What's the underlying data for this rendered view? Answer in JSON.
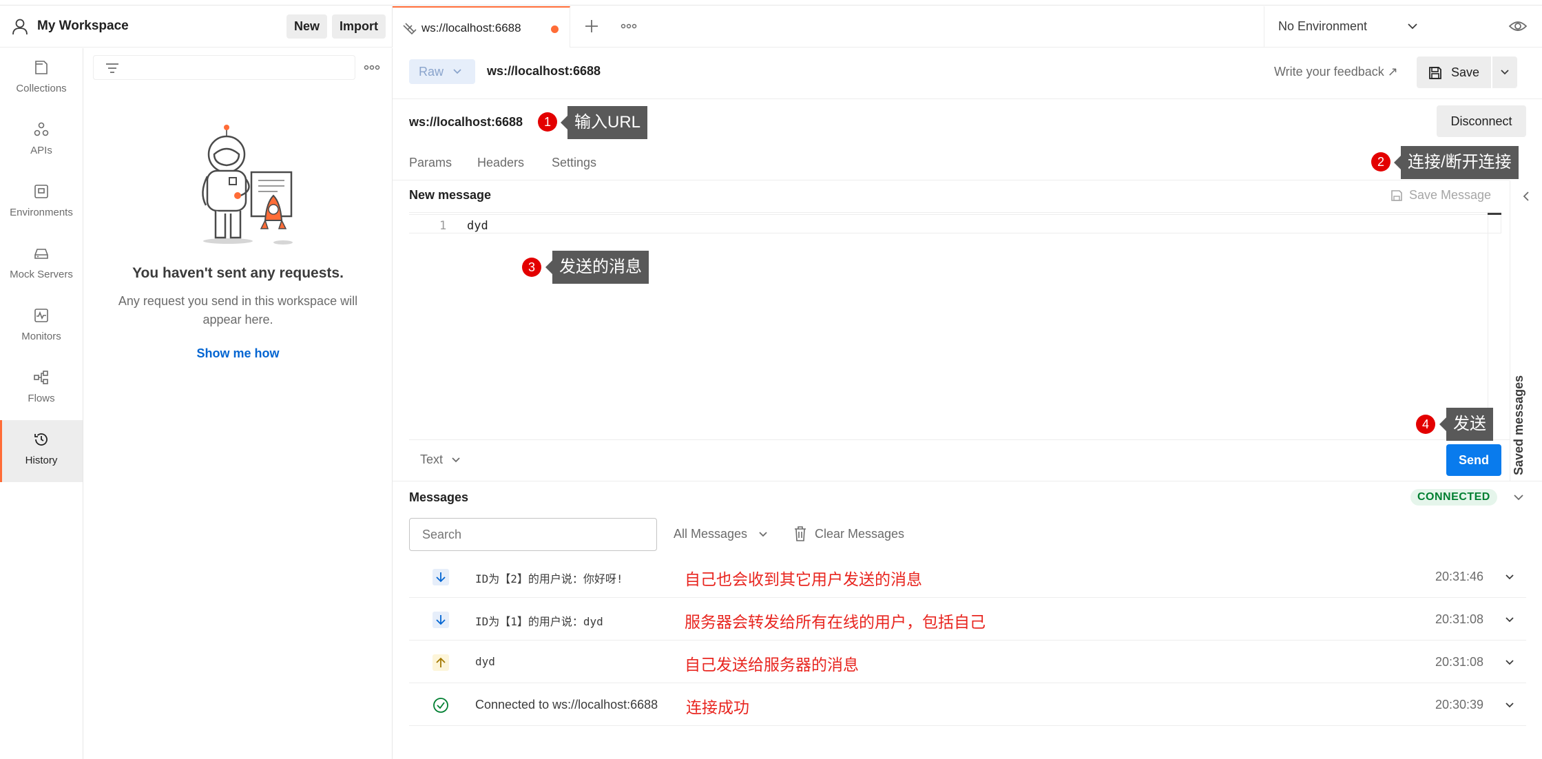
{
  "workspace": {
    "name": "My Workspace",
    "new_label": "New",
    "import_label": "Import"
  },
  "sidebar": {
    "items": [
      {
        "label": "Collections",
        "icon": "collections-icon"
      },
      {
        "label": "APIs",
        "icon": "apis-icon"
      },
      {
        "label": "Environments",
        "icon": "environments-icon"
      },
      {
        "label": "Mock Servers",
        "icon": "mock-servers-icon"
      },
      {
        "label": "Monitors",
        "icon": "monitors-icon"
      },
      {
        "label": "Flows",
        "icon": "flows-icon"
      },
      {
        "label": "History",
        "icon": "history-icon",
        "active": true
      }
    ]
  },
  "history": {
    "empty_title": "You haven't sent any requests.",
    "empty_desc": "Any request you send in this workspace will appear here.",
    "show_me_how": "Show me how"
  },
  "tab": {
    "title": "ws://localhost:6688",
    "unsaved": true
  },
  "environment": {
    "selected": "No Environment"
  },
  "request": {
    "mode": "Raw",
    "name": "ws://localhost:6688",
    "feedback": "Write your feedback ↗",
    "save_label": "Save",
    "url": "ws://localhost:6688",
    "disconnect_label": "Disconnect",
    "subtabs": [
      "Params",
      "Headers",
      "Settings"
    ]
  },
  "composer": {
    "title": "New message",
    "save_message_label": "Save Message",
    "lines": [
      {
        "num": "1",
        "text": "dyd"
      }
    ],
    "format": "Text",
    "send_label": "Send",
    "saved_messages_label": "Saved messages"
  },
  "messages": {
    "title": "Messages",
    "status": "CONNECTED",
    "search_placeholder": "Search",
    "filter": "All Messages",
    "clear_label": "Clear Messages",
    "rows": [
      {
        "direction": "incoming",
        "text": "ID为【2】的用户说：你好呀!",
        "time": "20:31:46",
        "note": "自己也会收到其它用户发送的消息"
      },
      {
        "direction": "incoming",
        "text": "ID为【1】的用户说：dyd",
        "time": "20:31:08",
        "note": "服务器会转发给所有在线的用户，包括自己"
      },
      {
        "direction": "outgoing",
        "text": "dyd",
        "time": "20:31:08",
        "note": "自己发送给服务器的消息"
      },
      {
        "direction": "connected",
        "text": "Connected to ws://localhost:6688",
        "time": "20:30:39",
        "note": "连接成功"
      }
    ]
  },
  "annotations": [
    {
      "num": "1",
      "text": "输入URL"
    },
    {
      "num": "2",
      "text": "连接/断开连接"
    },
    {
      "num": "3",
      "text": "发送的消息"
    },
    {
      "num": "4",
      "text": "发送"
    }
  ],
  "colors": {
    "accent": "#ff6c37",
    "primary": "#097bed",
    "link": "#0265d2",
    "connected": "#007f31",
    "annotation_red": "#e8251f",
    "callout_bg": "#595959"
  }
}
